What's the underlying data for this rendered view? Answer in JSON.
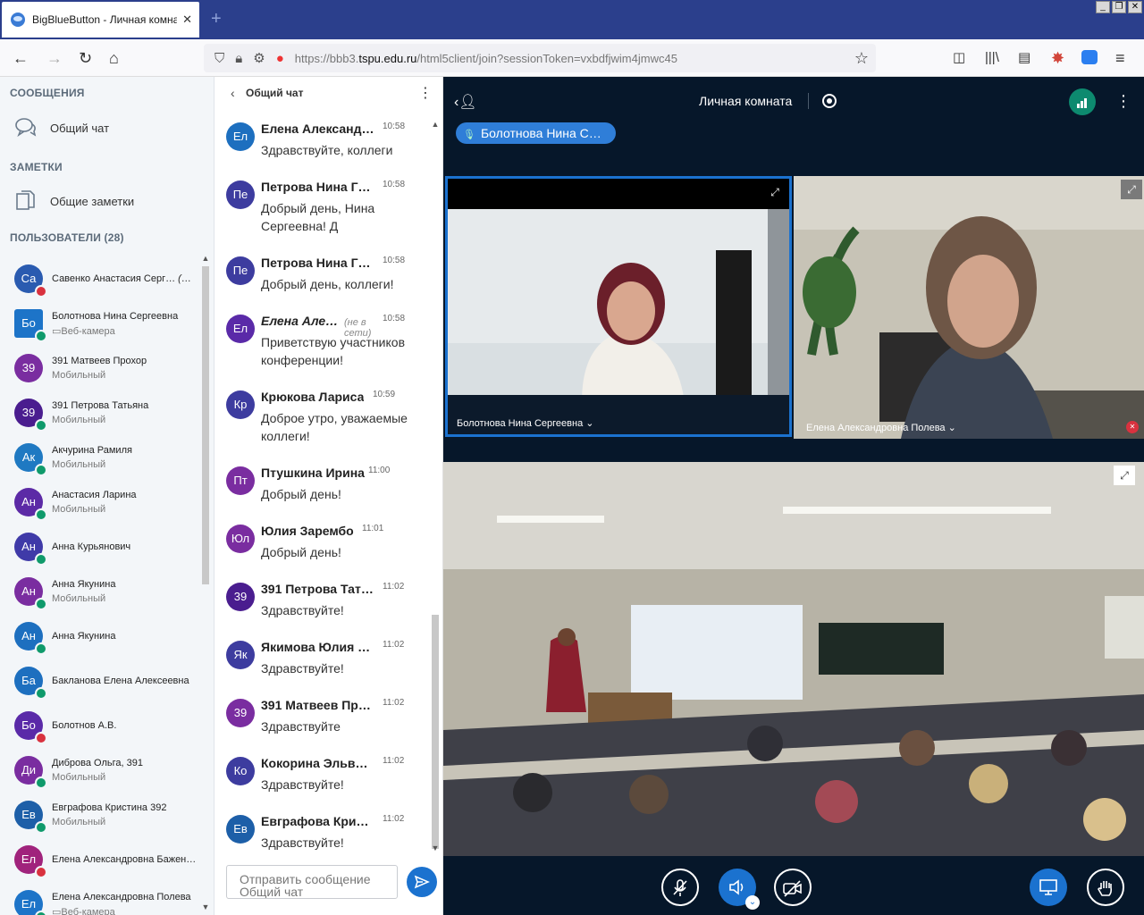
{
  "browser": {
    "tab_title": "BigBlueButton - Личная комната - ",
    "tab_close": "✕",
    "new_tab": "+",
    "url_prefix": "https://bbb3.",
    "url_host": "tspu.edu.ru",
    "url_path": "/html5client/join?sessionToken=vxbdfjwim4jmwc45"
  },
  "sidebar": {
    "messages_title": "СООБЩЕНИЯ",
    "public_chat_label": "Общий чат",
    "notes_title": "ЗАМЕТКИ",
    "shared_notes_label": "Общие заметки",
    "users_title": "ПОЛЬЗОВАТЕЛИ (28)",
    "users": [
      {
        "initials": "Са",
        "name": "Савенко Анастасия Серг…",
        "you": "(Вы)",
        "sub": "",
        "color": "#2a5bb0",
        "status": "red",
        "square": false
      },
      {
        "initials": "Бо",
        "name": "Болотнова Нина Сергеевна",
        "you": "",
        "sub": "▭Веб-камера",
        "color": "#1d74c8",
        "status": "green",
        "square": true
      },
      {
        "initials": "39",
        "name": "391 Матвеев Прохор",
        "you": "",
        "sub": "Мобильный",
        "color": "#7a2da0",
        "status": "",
        "square": false
      },
      {
        "initials": "39",
        "name": "391 Петрова Татьяна",
        "you": "",
        "sub": "Мобильный",
        "color": "#4a1d8f",
        "status": "green",
        "square": false
      },
      {
        "initials": "Ак",
        "name": "Акчурина Рамиля",
        "you": "",
        "sub": "Мобильный",
        "color": "#1f79c2",
        "status": "green",
        "square": false
      },
      {
        "initials": "Ан",
        "name": "Анастасия Ларина",
        "you": "",
        "sub": "Мобильный",
        "color": "#5c2aa6",
        "status": "green",
        "square": false
      },
      {
        "initials": "Ан",
        "name": "Анна Курьянович",
        "you": "",
        "sub": "",
        "color": "#3f3aa8",
        "status": "green",
        "square": false
      },
      {
        "initials": "Ан",
        "name": "Анна Якунина",
        "you": "",
        "sub": "Мобильный",
        "color": "#7a2da0",
        "status": "green",
        "square": false
      },
      {
        "initials": "Ан",
        "name": "Анна Якунина",
        "you": "",
        "sub": "",
        "color": "#1d6fbf",
        "status": "green",
        "square": false
      },
      {
        "initials": "Ба",
        "name": "Бакланова Елена Алексеевна",
        "you": "",
        "sub": "",
        "color": "#1d6fbf",
        "status": "green",
        "square": false
      },
      {
        "initials": "Бо",
        "name": "Болотнов А.В.",
        "you": "",
        "sub": "",
        "color": "#5a2aa8",
        "status": "red",
        "square": false
      },
      {
        "initials": "Ди",
        "name": "Диброва Ольга, 391",
        "you": "",
        "sub": "Мобильный",
        "color": "#7a2da0",
        "status": "green",
        "square": false
      },
      {
        "initials": "Ев",
        "name": "Евграфова Кристина 392",
        "you": "",
        "sub": "Мобильный",
        "color": "#1d5fa8",
        "status": "green",
        "square": false
      },
      {
        "initials": "Ел",
        "name": "Елена Александровна Бажен…",
        "you": "",
        "sub": "",
        "color": "#a0237c",
        "status": "red",
        "square": false
      },
      {
        "initials": "Ел",
        "name": "Елена Александровна Полева",
        "you": "",
        "sub": "▭Веб-камера",
        "color": "#1d74c8",
        "status": "green",
        "square": false
      }
    ]
  },
  "chat": {
    "title": "Общий чат",
    "input_placeholder": "Отправить сообщение Общий чат",
    "messages": [
      {
        "initials": "Ел",
        "color": "#1d6fbf",
        "name": "Елена Александ…",
        "time": "10:58",
        "text": "Здравствуйте, коллеги",
        "offline": "",
        "italic": false
      },
      {
        "initials": "Пе",
        "color": "#3d3c9f",
        "name": "Петрова Нина Г…",
        "time": "10:58",
        "text": "Добрый день, Нина Сергеевна! Д",
        "offline": "",
        "italic": false
      },
      {
        "initials": "Пе",
        "color": "#3d3c9f",
        "name": "Петрова Нина Г…",
        "time": "10:58",
        "text": "Добрый день, коллеги!",
        "offline": "",
        "italic": false
      },
      {
        "initials": "Ел",
        "color": "#5a2aa8",
        "name": "Елена Але…",
        "time": "10:58",
        "text": "Приветствую участников конференции!",
        "offline": "(не в сети)",
        "italic": true
      },
      {
        "initials": "Кр",
        "color": "#3d3c9f",
        "name": "Крюкова Лариса",
        "time": "10:59",
        "text": "Доброе утро, уважаемые коллеги!",
        "offline": "",
        "italic": false
      },
      {
        "initials": "Пт",
        "color": "#7a2da0",
        "name": "Птушкина Ирина",
        "time": "11:00",
        "text": "Добрый день!",
        "offline": "",
        "italic": false
      },
      {
        "initials": "Юл",
        "color": "#7a2da0",
        "name": "Юлия Зарембо",
        "time": "11:01",
        "text": "Добрый день!",
        "offline": "",
        "italic": false
      },
      {
        "initials": "39",
        "color": "#4a1d8f",
        "name": "391 Петрова Тат…",
        "time": "11:02",
        "text": "Здравствуйте!",
        "offline": "",
        "italic": false
      },
      {
        "initials": "Як",
        "color": "#3d3c9f",
        "name": "Якимова Юлия З…",
        "time": "11:02",
        "text": "Здравствуйте!",
        "offline": "",
        "italic": false
      },
      {
        "initials": "39",
        "color": "#7a2da0",
        "name": "391 Матвеев Пр…",
        "time": "11:02",
        "text": "Здравствуйте",
        "offline": "",
        "italic": false
      },
      {
        "initials": "Ко",
        "color": "#3d3c9f",
        "name": "Кокорина Эльв…",
        "time": "11:02",
        "text": "Здравствуйте!",
        "offline": "",
        "italic": false
      },
      {
        "initials": "Ев",
        "color": "#1d5fa8",
        "name": "Евграфова Кри…",
        "time": "11:02",
        "text": "Здравствуйте!",
        "offline": "",
        "italic": false
      }
    ]
  },
  "main": {
    "room_title": "Личная комната",
    "talking_user": "Болотнова Нина С…",
    "video1_label": "Болотнова Нина Сергеевна ⌄",
    "video2_label": "Елена Александровна Полева ⌄"
  },
  "colors": {
    "accent_blue": "#1b72cf",
    "main_bg": "#06172a",
    "sidebar_bg": "#f3f6f9",
    "browser_tabbar": "#2b3f8c"
  }
}
